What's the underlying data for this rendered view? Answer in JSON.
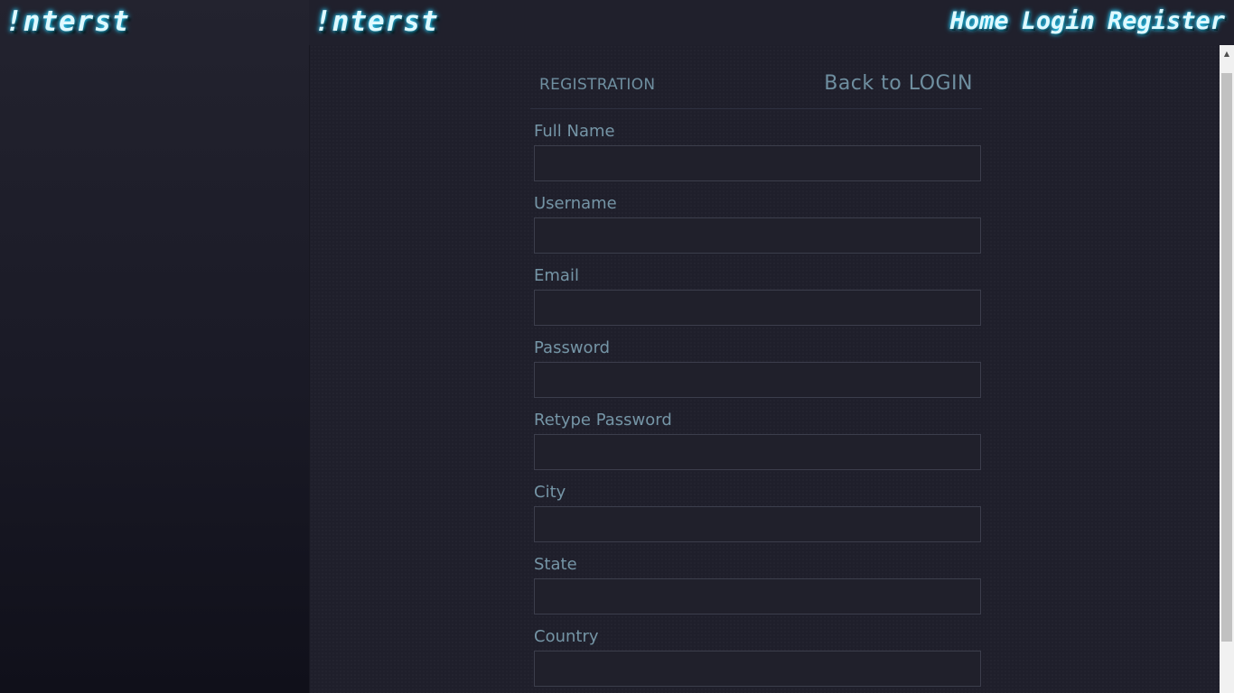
{
  "sidebar": {
    "logo": "!nterst"
  },
  "header": {
    "logo": "!nterst",
    "nav": {
      "home": "Home",
      "login": "Login",
      "register": "Register"
    }
  },
  "form": {
    "title": "REGISTRATION",
    "back_link": "Back to LOGIN",
    "fields": [
      {
        "label": "Full Name",
        "value": ""
      },
      {
        "label": "Username",
        "value": ""
      },
      {
        "label": "Email",
        "value": ""
      },
      {
        "label": "Password",
        "value": ""
      },
      {
        "label": "Retype Password",
        "value": ""
      },
      {
        "label": "City",
        "value": ""
      },
      {
        "label": "State",
        "value": ""
      },
      {
        "label": "Country",
        "value": ""
      }
    ]
  },
  "scrollbar": {
    "up_icon": "scroll-up-arrow-icon"
  }
}
